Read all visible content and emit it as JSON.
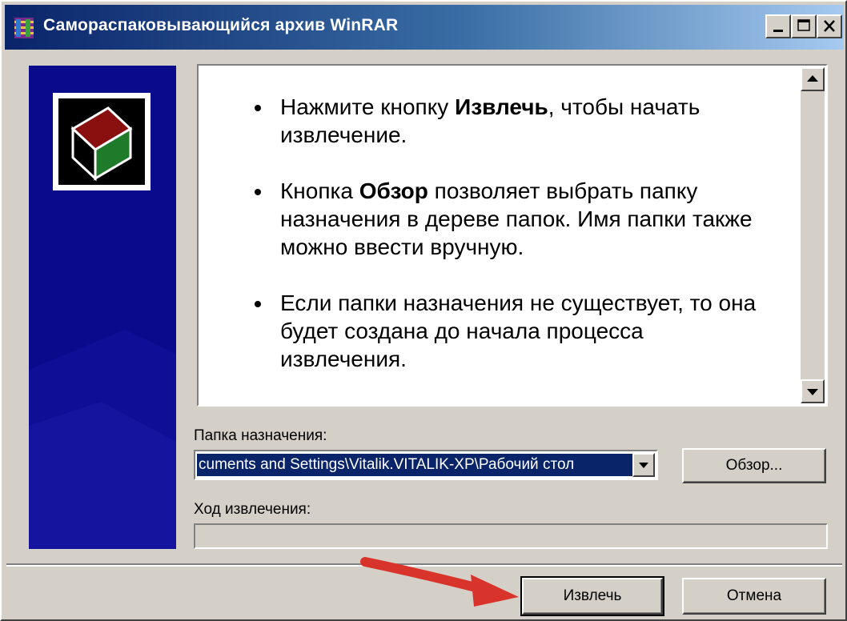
{
  "window": {
    "title": "Самораспаковывающийся архив WinRAR"
  },
  "titlebar_buttons": {
    "minimize": "minimize-icon",
    "maximize": "maximize-icon",
    "close": "close-icon"
  },
  "info": {
    "bullets": [
      {
        "before": "Нажмите кнопку ",
        "bold": "Извлечь",
        "after": ", чтобы начать извлечение."
      },
      {
        "before": "Кнопка ",
        "bold": "Обзор",
        "after": " позволяет выбрать папку назначения в дереве папок. Имя папки также можно ввести вручную."
      },
      {
        "before": "",
        "bold": "",
        "after": "Если папки назначения не существует, то она будет создана до начала процесса извлечения."
      }
    ]
  },
  "destination": {
    "label": "Папка назначения:",
    "value": "cuments and Settings\\Vitalik.VITALIK-XP\\Рабочий стол",
    "browse_label": "Обзор..."
  },
  "progress": {
    "label": "Ход извлечения:",
    "value": 0
  },
  "buttons": {
    "extract_label": "Извлечь",
    "cancel_label": "Отмена"
  },
  "colors": {
    "titlebar_start": "#0a246a",
    "banner": "#0a0a8c",
    "annotation_arrow": "#d9342b"
  }
}
